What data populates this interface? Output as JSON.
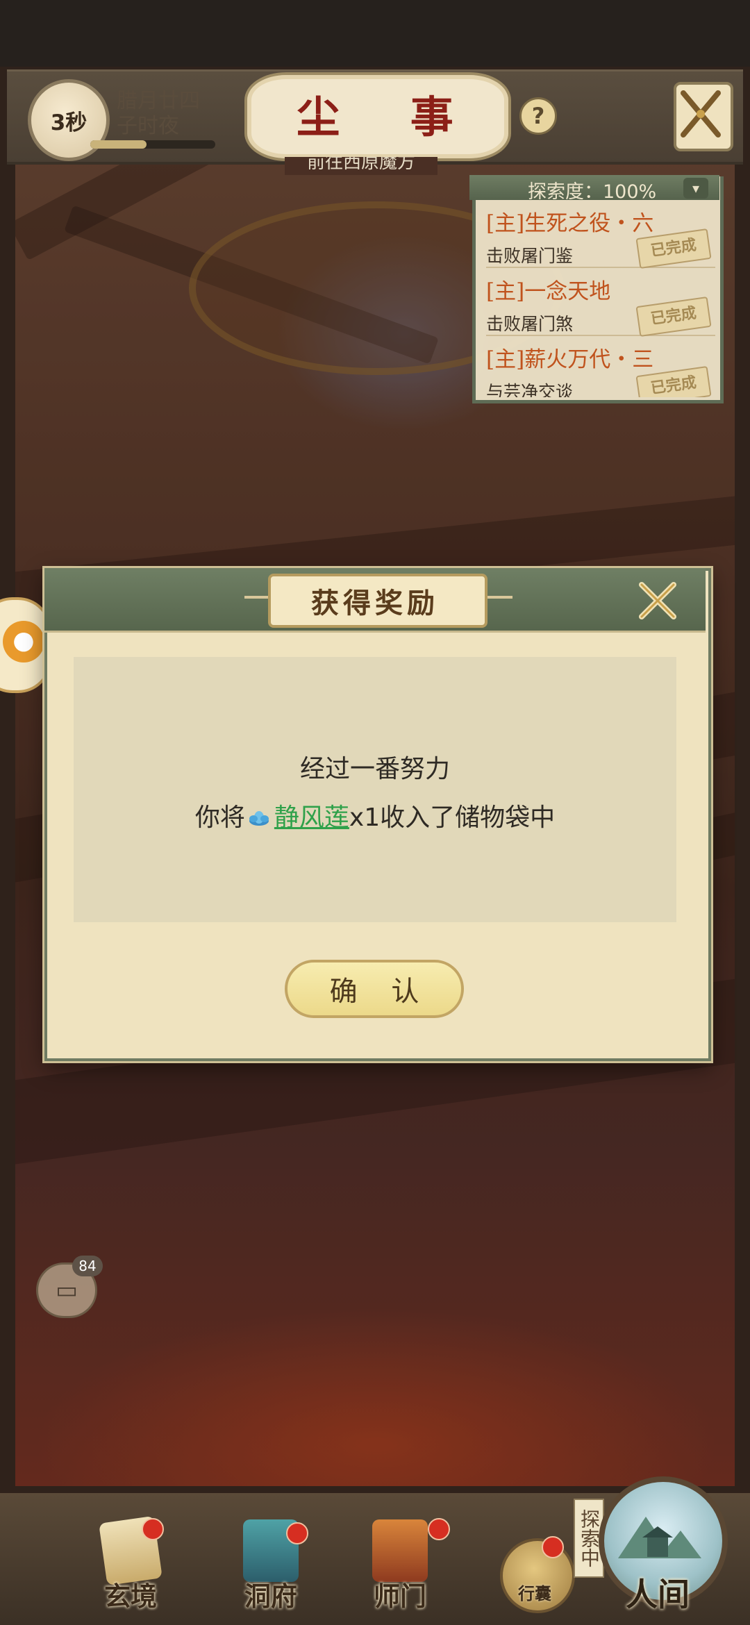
{
  "header": {
    "timer": "3秒",
    "date_line1": "腊月廿四",
    "date_line2": "子时夜",
    "title": "尘 事",
    "help_label": "?",
    "time_progress": 0.45,
    "quest_hint": "前往西原魔方"
  },
  "explore_panel": {
    "label": "探索度：100%",
    "toggle_icon": "chevron-down-icon",
    "quests": [
      {
        "name": "[主]生死之役・六",
        "desc": "击败屠门鉴",
        "status": "已完成"
      },
      {
        "name": "[主]一念天地",
        "desc": "击败屠门煞",
        "status": "已完成"
      },
      {
        "name": "[主]薪火万代・三",
        "desc": "与芸净交谈",
        "status": "已完成"
      }
    ]
  },
  "dialog": {
    "title": "获得奖励",
    "message_line1": "经过一番努力",
    "message_prefix": "你将",
    "item_icon": "lotus-icon",
    "item_name": "静风莲",
    "message_suffix": "x1收入了储物袋中",
    "confirm_label": "确 认"
  },
  "chat": {
    "unread_count": "84"
  },
  "bottom_nav": {
    "items": [
      {
        "label": "玄境",
        "icon": "scroll-icon"
      },
      {
        "label": "洞府",
        "icon": "lantern-icon"
      },
      {
        "label": "师门",
        "icon": "banner-icon"
      }
    ],
    "bag_label": "行囊",
    "explore_tag": "探索中",
    "world_label": "人间"
  },
  "colors": {
    "title_red": "#8c1f17",
    "quest_orange": "#c0531d",
    "item_green": "#2fa14a",
    "panel_green": "#6f7f64",
    "badge_red": "#d62e21"
  }
}
